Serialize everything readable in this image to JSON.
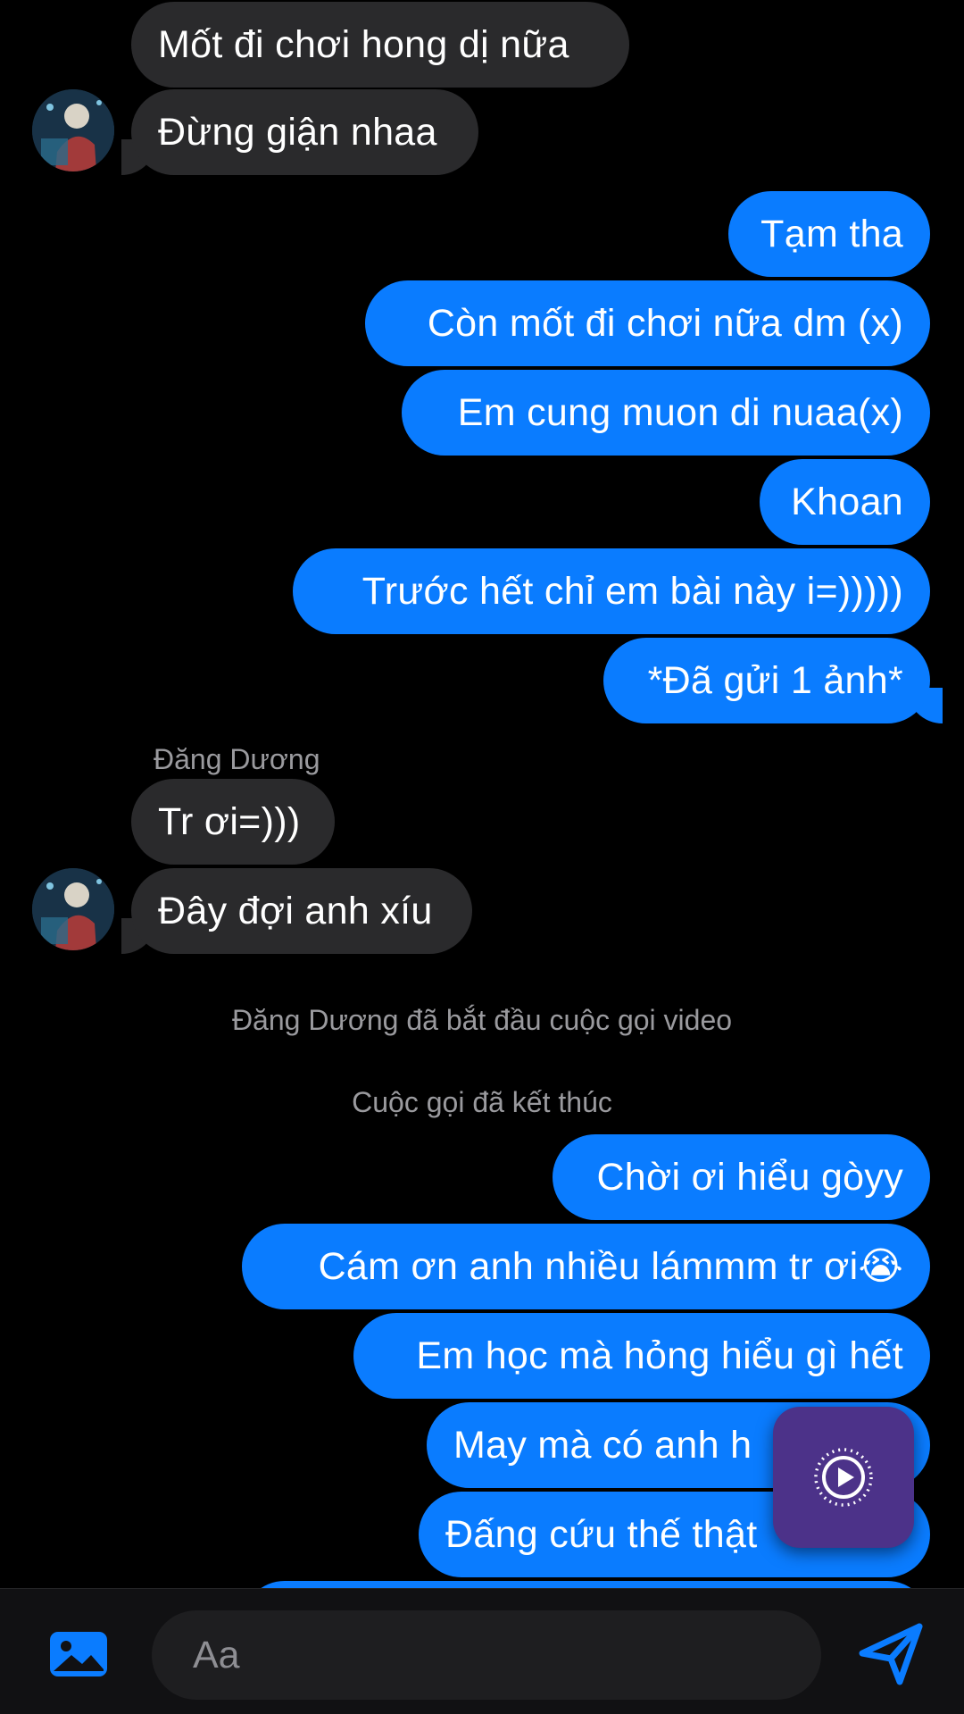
{
  "colors": {
    "outgoing_bubble": "#0a7cff",
    "incoming_bubble": "#2a2a2c",
    "background": "#000000",
    "floating_button": "#4c3289"
  },
  "messages": {
    "m1": "Mốt đi chơi hong dị nữa",
    "m2": "Đừng giận nhaa",
    "m3": "Tạm tha",
    "m4": "Còn mốt đi chơi nữa dm (x)",
    "m5": "Em cung muon di nuaa(x)",
    "m6": "Khoan",
    "m7": "Trước hết chỉ em bài này i=)))))",
    "m8": "*Đã gửi 1 ảnh*",
    "sender": "Đăng Dương",
    "m9": "Tr ơi=)))",
    "m10": "Đây đợi anh xíu",
    "sys1": "Đăng Dương đã bắt đầu cuộc gọi video",
    "sys2": "Cuộc gọi đã kết thúc",
    "m11": "Chời ơi hiểu gòyy",
    "m12": "Cám ơn anh nhiều lámmm tr ơi😭",
    "m13": "Em học mà hỏng hiểu gì hết",
    "m14": "May mà có anh h",
    "m15": "Đấng cứu thế thật"
  },
  "composer": {
    "placeholder": "Aa"
  },
  "icons": {
    "left": "image-icon",
    "right": "send-icon",
    "floating": "play-circle-icon"
  }
}
